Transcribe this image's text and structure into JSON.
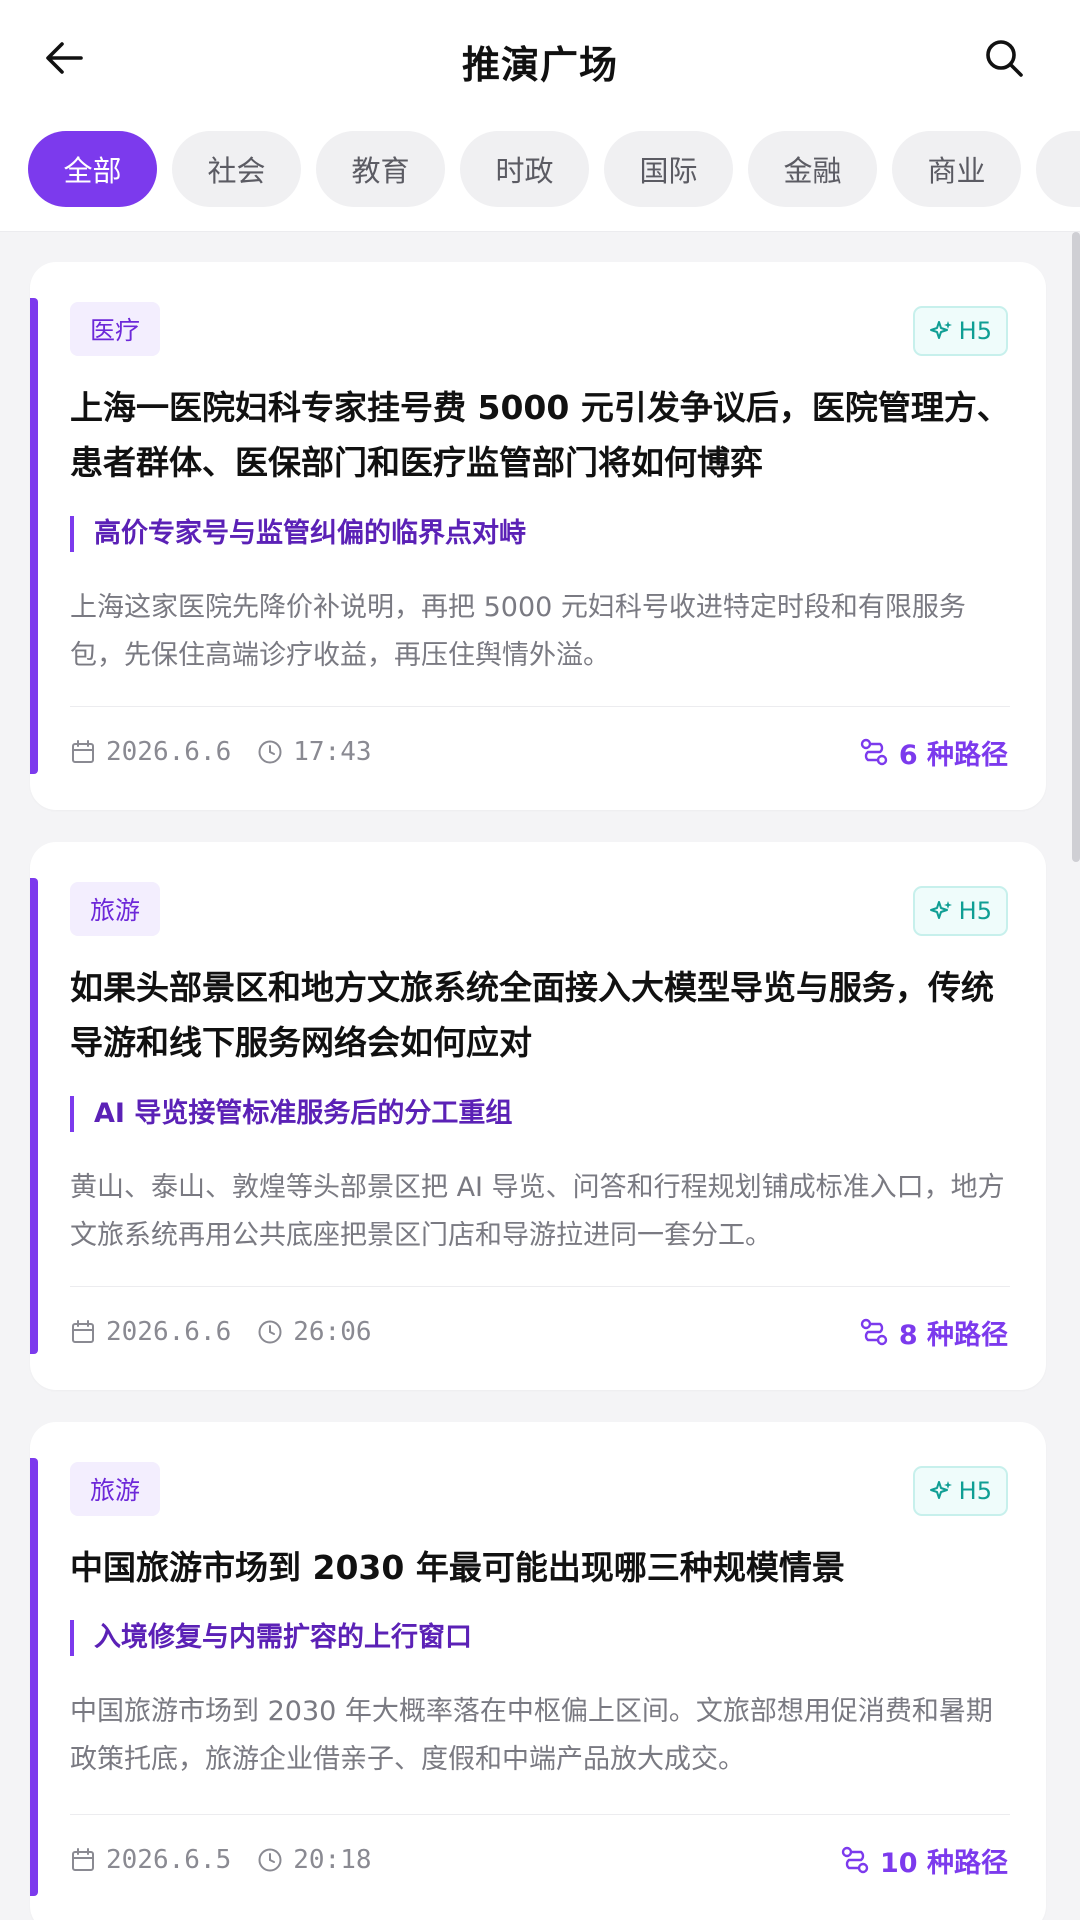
{
  "header": {
    "title": "推演广场",
    "back_icon": "arrow-left-icon",
    "search_icon": "search-icon"
  },
  "tabs": [
    {
      "label": "全部",
      "active": true
    },
    {
      "label": "社会"
    },
    {
      "label": "教育"
    },
    {
      "label": "时政"
    },
    {
      "label": "国际"
    },
    {
      "label": "金融"
    },
    {
      "label": "商业"
    },
    {
      "label": ""
    }
  ],
  "cards": [
    {
      "tag": "医疗",
      "badge": "H5",
      "title": "上海一医院妇科专家挂号费 5000 元引发争议后，医院管理方、患者群体、医保部门和医疗监管部门将如何博弈",
      "subhead": "高价专家号与监管纠偏的临界点对峙",
      "summary": "上海这家医院先降价补说明，再把 5000 元妇科号收进特定时段和有限服务包，先保住高端诊疗收益，再压住舆情外溢。",
      "date": "2026.6.6",
      "time": "17:43",
      "paths": "6 种路径"
    },
    {
      "tag": "旅游",
      "badge": "H5",
      "title": "如果头部景区和地方文旅系统全面接入大模型导览与服务，传统导游和线下服务网络会如何应对",
      "subhead": "AI 导览接管标准服务后的分工重组",
      "summary": "黄山、泰山、敦煌等头部景区把 AI 导览、问答和行程规划铺成标准入口，地方文旅系统再用公共底座把景区门店和导游拉进同一套分工。",
      "date": "2026.6.6",
      "time": "26:06",
      "paths": "8 种路径"
    },
    {
      "tag": "旅游",
      "badge": "H5",
      "title": "中国旅游市场到 2030 年最可能出现哪三种规模情景",
      "subhead": "入境修复与内需扩容的上行窗口",
      "summary": "中国旅游市场到 2030 年大概率落在中枢偏上区间。文旅部想用促消费和暑期政策托底，旅游企业借亲子、度假和中端产品放大成交。",
      "date": "2026.6.5",
      "time": "20:18",
      "paths": "10 种路径"
    }
  ],
  "colors": {
    "accent": "#7c3aed",
    "badge_teal": "#0f9e94",
    "background": "#f4f4f6"
  }
}
